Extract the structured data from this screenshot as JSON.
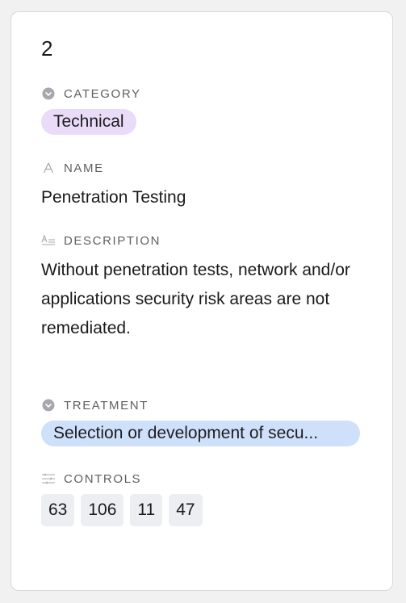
{
  "record": {
    "id": "2"
  },
  "category": {
    "label": "CATEGORY",
    "value": "Technical",
    "color": "#eadcf8"
  },
  "name": {
    "label": "NAME",
    "value": "Penetration Testing"
  },
  "description": {
    "label": "DESCRIPTION",
    "value": "Without penetration tests, network and/or applications security risk areas are not remediated."
  },
  "treatment": {
    "label": "TREATMENT",
    "value": "Selection or development of secu...",
    "color": "#cfe0fb"
  },
  "controls": {
    "label": "CONTROLS",
    "items": [
      "63",
      "106",
      "11",
      "47"
    ]
  },
  "icons": {
    "category": "single-select-icon",
    "name": "text-field-icon",
    "description": "long-text-icon",
    "treatment": "single-select-icon",
    "controls": "linked-records-icon"
  }
}
